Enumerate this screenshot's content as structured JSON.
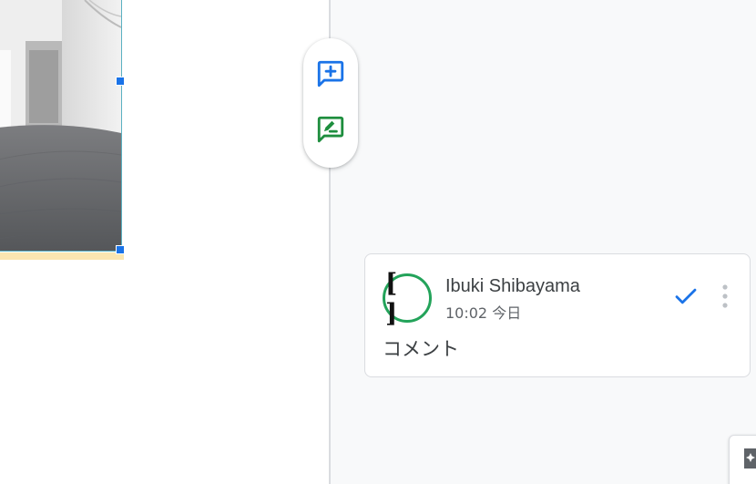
{
  "comment": {
    "author": "Ibuki Shibayama",
    "timestamp": "10:02 今日",
    "body": "コメント",
    "avatar_text": "[ ]"
  },
  "actions": {
    "add_comment_icon": "add-comment-icon",
    "suggest_edit_icon": "suggest-edit-icon"
  },
  "colors": {
    "accent_blue": "#1a73e8",
    "accent_green": "#1e8e3e",
    "avatar_ring": "#23a35a",
    "sidebar_bg": "#f8f9fa"
  }
}
